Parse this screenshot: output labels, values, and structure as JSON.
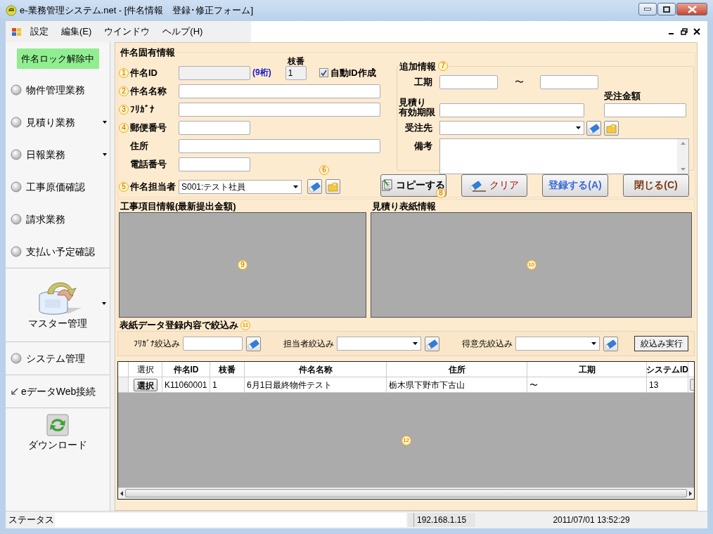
{
  "window": {
    "title": "e-業務管理システム.net - [件名情報　登録･修正フォーム]"
  },
  "menu": {
    "items": [
      "設定",
      "編集(E)",
      "ウインドウ",
      "ヘルプ(H)"
    ]
  },
  "sidebar": {
    "lock_status": "件名ロック解除中",
    "groups": [
      [
        {
          "kind": "radio",
          "label": "物件管理業務",
          "dropdown": false
        },
        {
          "kind": "radio",
          "label": "見積り業務",
          "dropdown": true
        },
        {
          "kind": "radio",
          "label": "日報業務",
          "dropdown": true
        },
        {
          "kind": "radio",
          "label": "工事原価確認",
          "dropdown": false
        },
        {
          "kind": "radio",
          "label": "請求業務",
          "dropdown": false
        },
        {
          "kind": "radio",
          "label": "支払い予定確認",
          "dropdown": false
        }
      ],
      [
        {
          "kind": "large_icon",
          "label": "マスター管理",
          "dropdown": true
        }
      ],
      [
        {
          "kind": "radio",
          "label": "システム管理",
          "dropdown": false
        }
      ],
      [
        {
          "kind": "link",
          "label": "eデータWeb接続",
          "dropdown": false
        }
      ],
      [
        {
          "kind": "icon",
          "label": "ダウンロード",
          "dropdown": false
        }
      ]
    ]
  },
  "project_info": {
    "title": "件名固有情報",
    "id_row": {
      "marker": "1",
      "label": "件名ID",
      "hint": "(9桁)",
      "branch_label": "枝番",
      "branch_value": "1",
      "auto_id": {
        "label": "自動ID作成",
        "checked": true
      }
    },
    "fields": [
      {
        "kind": "text",
        "marker": "2",
        "label": "件名名称"
      },
      {
        "kind": "text",
        "marker": "3",
        "label": "ﾌﾘｶﾞﾅ"
      },
      {
        "kind": "short_text",
        "marker": "4",
        "label": "郵便番号"
      },
      {
        "kind": "text",
        "label": "住所"
      },
      {
        "kind": "short_text",
        "label": "電話番号"
      },
      {
        "kind": "select",
        "marker": "5",
        "label": "件名担当者",
        "value": "S001:テスト社員",
        "tools_marker": "6"
      }
    ]
  },
  "additional_info": {
    "title": "追加情報",
    "marker": "7",
    "period": {
      "label": "工期",
      "separator": "〜"
    },
    "validity": {
      "label_lines": [
        "見積り",
        "有効期限"
      ]
    },
    "order_amount": {
      "label": "受注金額"
    },
    "client": {
      "label": "受注先"
    },
    "notes": {
      "label": "備考"
    }
  },
  "actions": [
    {
      "kind": "copy",
      "label": "コピーする",
      "marker": "8"
    },
    {
      "kind": "clear",
      "label": "クリア"
    },
    {
      "kind": "register",
      "label": "登録する(A)"
    },
    {
      "kind": "close",
      "label": "閉じる(C)"
    }
  ],
  "panels": [
    {
      "title": "工事項目情報(最新提出金額)",
      "marker": "9"
    },
    {
      "title": "見積り表紙情報",
      "marker": "10"
    }
  ],
  "filter": {
    "title": "表紙データ登録内容で絞込み",
    "marker": "11",
    "fields": [
      {
        "kind": "text",
        "label": "ﾌﾘｶﾞﾅ絞込み"
      },
      {
        "kind": "select",
        "label": "担当者絞込み"
      },
      {
        "kind": "select",
        "label": "得意先絞込み"
      }
    ],
    "button": "絞込み実行"
  },
  "table": {
    "columns": [
      "選択",
      "件名ID",
      "枝番",
      "件名名称",
      "住所",
      "工期",
      "システムID"
    ],
    "marker": "12",
    "rows": [
      {
        "cells": [
          "選択",
          "K11060001",
          "1",
          "6月1日最終物件テスト",
          "栃木県下野市下古山",
          "〜",
          "13"
        ]
      }
    ]
  },
  "status_bar": {
    "status": "ステータス",
    "ip": "192.168.1.15",
    "datetime": "2011/07/01 13:52:29"
  }
}
